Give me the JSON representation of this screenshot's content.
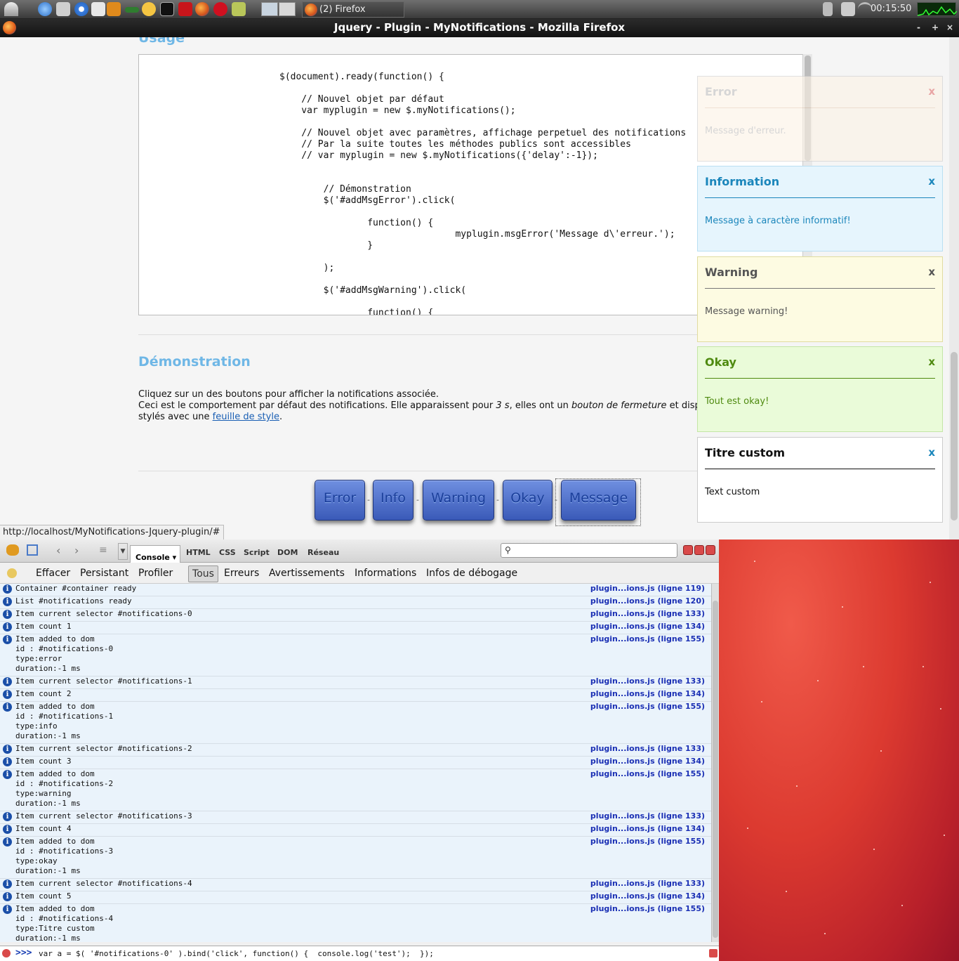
{
  "taskbar": {
    "task_label": "(2) Firefox",
    "clock": "00:15:50"
  },
  "window": {
    "title": "Jquery - Plugin - MyNotifications - Mozilla Firefox",
    "buttons": [
      "-",
      "+",
      "×"
    ]
  },
  "page": {
    "usage_heading": "Usage",
    "code": "$(document).ready(function() {\n\n    // Nouvel objet par défaut\n    var myplugin = new $.myNotifications();\n\n    // Nouvel objet avec paramètres, affichage perpetuel des notifications\n    // Par la suite toutes les méthodes publics sont accessibles\n    // var myplugin = new $.myNotifications({'delay':-1});\n\n\n        // Démonstration\n        $('#addMsgError').click(\n\n                function() {\n                                myplugin.msgError('Message d\\'erreur.');\n                }\n\n        );\n\n        $('#addMsgWarning').click(\n\n                function() {",
    "demo_heading": "Démonstration",
    "demo_line1": "Cliquez sur un des boutons pour afficher la notifications associée.",
    "demo_line2_a": "Ceci est le comportement par défaut des notifications. Elle apparaissent pour ",
    "demo_line2_b": "3 s",
    "demo_line2_c": ", elles ont un ",
    "demo_line2_d": "bouton de fermeture",
    "demo_line2_e": " et disparaissent autom",
    "demo_line3_a": "stylés avec une ",
    "demo_line3_link": "feuille de style",
    "demo_line3_b": ".",
    "buttons": {
      "error": "Error",
      "info": "Info",
      "warning": "Warning",
      "okay": "Okay",
      "message": "Message",
      "separator": "-"
    }
  },
  "notifications": {
    "error": {
      "title": "Error",
      "close": "x",
      "message": "Message d'erreur."
    },
    "info": {
      "title": "Information",
      "close": "x",
      "message": "Message à caractère informatif!"
    },
    "warning": {
      "title": "Warning",
      "close": "x",
      "message": "Message warning!"
    },
    "okay": {
      "title": "Okay",
      "close": "x",
      "message": "Tout est okay!"
    },
    "custom": {
      "title": "Titre custom",
      "close": "x",
      "message": "Text custom"
    }
  },
  "status_url": "http://localhost/MyNotifications-Jquery-plugin/#",
  "firebug": {
    "tabs": {
      "console": "Console ▾",
      "html": "HTML",
      "css": "CSS",
      "script": "Script",
      "dom": "DOM",
      "reseau": "Réseau"
    },
    "filters": {
      "effacer": "Effacer",
      "persistant": "Persistant",
      "profiler": "Profiler",
      "tous": "Tous",
      "erreurs": "Erreurs",
      "avertissements": "Avertissements",
      "informations": "Informations",
      "debogage": "Infos de débogage"
    },
    "log": [
      {
        "text": "Container #container ready",
        "source": "plugin...ions.js (ligne 119)"
      },
      {
        "text": "List #notifications ready",
        "source": "plugin...ions.js (ligne 120)"
      },
      {
        "text": "Item current selector #notifications-0",
        "source": "plugin...ions.js (ligne 133)"
      },
      {
        "text": "Item count 1",
        "source": "plugin...ions.js (ligne 134)"
      },
      {
        "text": "Item added to dom\nid : #notifications-0\ntype:error\nduration:-1 ms",
        "source": "plugin...ions.js (ligne 155)"
      },
      {
        "text": "Item current selector #notifications-1",
        "source": "plugin...ions.js (ligne 133)"
      },
      {
        "text": "Item count 2",
        "source": "plugin...ions.js (ligne 134)"
      },
      {
        "text": "Item added to dom\nid : #notifications-1\ntype:info\nduration:-1 ms",
        "source": "plugin...ions.js (ligne 155)"
      },
      {
        "text": "Item current selector #notifications-2",
        "source": "plugin...ions.js (ligne 133)"
      },
      {
        "text": "Item count 3",
        "source": "plugin...ions.js (ligne 134)"
      },
      {
        "text": "Item added to dom\nid : #notifications-2\ntype:warning\nduration:-1 ms",
        "source": "plugin...ions.js (ligne 155)"
      },
      {
        "text": "Item current selector #notifications-3",
        "source": "plugin...ions.js (ligne 133)"
      },
      {
        "text": "Item count 4",
        "source": "plugin...ions.js (ligne 134)"
      },
      {
        "text": "Item added to dom\nid : #notifications-3\ntype:okay\nduration:-1 ms",
        "source": "plugin...ions.js (ligne 155)"
      },
      {
        "text": "Item current selector #notifications-4",
        "source": "plugin...ions.js (ligne 133)"
      },
      {
        "text": "Item count 5",
        "source": "plugin...ions.js (ligne 134)"
      },
      {
        "text": "Item added to dom\nid : #notifications-4\ntype:Titre custom\nduration:-1 ms",
        "source": "plugin...ions.js (ligne 155)"
      }
    ],
    "command_prompt": ">>>",
    "command": "var a = $( '#notifications-0' ).bind('click', function() {  console.log('test');  });"
  },
  "colors": {
    "heading": "#6fb7e6",
    "info": "#1b86bb",
    "okay": "#4f8a10",
    "link": "#1a5fb4",
    "desktop": "#dc3a30"
  }
}
